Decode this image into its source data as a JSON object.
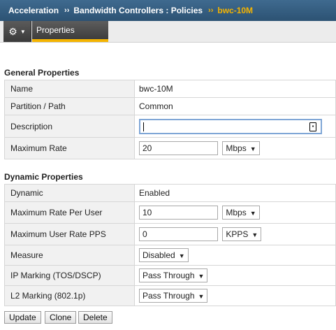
{
  "breadcrumb": {
    "items": [
      "Acceleration",
      "Bandwidth Controllers : Policies",
      "bwc-10M"
    ],
    "separator": "››"
  },
  "tabs": {
    "menu_icon": "gear-icon",
    "active": "Properties"
  },
  "general": {
    "title": "General Properties",
    "name_label": "Name",
    "name_value": "bwc-10M",
    "partition_label": "Partition / Path",
    "partition_value": "Common",
    "description_label": "Description",
    "description_value": "",
    "max_rate_label": "Maximum Rate",
    "max_rate_value": "20",
    "max_rate_unit": "Mbps"
  },
  "dynamic": {
    "title": "Dynamic Properties",
    "dynamic_label": "Dynamic",
    "dynamic_value": "Enabled",
    "max_rate_per_user_label": "Maximum Rate Per User",
    "max_rate_per_user_value": "10",
    "max_rate_per_user_unit": "Mbps",
    "max_user_rate_pps_label": "Maximum User Rate PPS",
    "max_user_rate_pps_value": "0",
    "max_user_rate_pps_unit": "KPPS",
    "measure_label": "Measure",
    "measure_value": "Disabled",
    "ip_marking_label": "IP Marking (TOS/DSCP)",
    "ip_marking_value": "Pass Through",
    "l2_marking_label": "L2 Marking (802.1p)",
    "l2_marking_value": "Pass Through"
  },
  "actions": {
    "update": "Update",
    "clone": "Clone",
    "delete": "Delete"
  },
  "colors": {
    "header_bg": "#34597c",
    "accent": "#f5b400",
    "label_bg": "#f1f1f1"
  }
}
